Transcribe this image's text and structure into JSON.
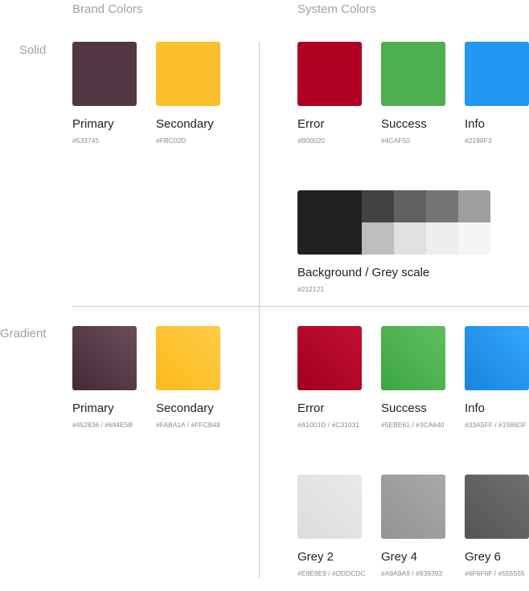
{
  "headers": {
    "brand": "Brand Colors",
    "system": "System Colors"
  },
  "rows": {
    "solid": "Solid",
    "gradient": "Gradient"
  },
  "solid": {
    "brand": [
      {
        "name": "Primary",
        "hex": "#533745",
        "color": "#533745"
      },
      {
        "name": "Secondary",
        "hex": "#FBC02D",
        "color": "#FBC02D"
      }
    ],
    "system": [
      {
        "name": "Error",
        "hex": "#B00020",
        "color": "#B00020"
      },
      {
        "name": "Success",
        "hex": "#4CAF50",
        "color": "#4CAF50"
      },
      {
        "name": "Info",
        "hex": "#2196F3",
        "color": "#2196F3"
      }
    ],
    "background": {
      "name": "Background / Grey scale",
      "hex": "#212121",
      "color": "#212121",
      "grey_top": [
        "#424242",
        "#616161",
        "#757575",
        "#9E9E9E"
      ],
      "grey_bottom": [
        "#BDBDBD",
        "#E0E0E0",
        "#EEEEEE",
        "#F5F5F5"
      ]
    }
  },
  "gradient": {
    "brand": [
      {
        "name": "Primary",
        "hex": "#452836 / #694E5B",
        "from": "#452836",
        "to": "#694E5B"
      },
      {
        "name": "Secondary",
        "hex": "#FABA1A / #FFCB48",
        "from": "#FABA1A",
        "to": "#FFCB48"
      }
    ],
    "system": [
      {
        "name": "Error",
        "hex": "#A1001D / #C31031",
        "from": "#A1001D",
        "to": "#C31031"
      },
      {
        "name": "Success",
        "hex": "#5EBE61 / #3CA640",
        "from": "#3CA640",
        "to": "#5EBE61"
      },
      {
        "name": "Info",
        "hex": "#33A5FF / #1586DF",
        "from": "#1586DF",
        "to": "#33A5FF"
      }
    ],
    "greys": [
      {
        "name": "Grey 2",
        "hex": "#E9E9E9 / #DDDCDC",
        "from": "#DDDCDC",
        "to": "#E9E9E9"
      },
      {
        "name": "Grey 4",
        "hex": "#A9A9A9 / #939393",
        "from": "#939393",
        "to": "#A9A9A9"
      },
      {
        "name": "Grey 6",
        "hex": "#6F6F6F / #555555",
        "from": "#555555",
        "to": "#6F6F6F"
      }
    ]
  }
}
